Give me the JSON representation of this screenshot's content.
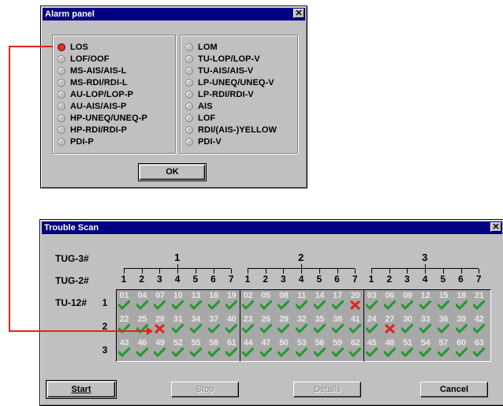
{
  "alarm_panel": {
    "title": "Alarm panel",
    "close_label": "✕",
    "left_options": [
      {
        "label": "LOS",
        "selected": true
      },
      {
        "label": "LOF/OOF",
        "selected": false
      },
      {
        "label": "MS-AIS/AIS-L",
        "selected": false
      },
      {
        "label": "MS-RDI/RDI-L",
        "selected": false
      },
      {
        "label": "AU-LOP/LOP-P",
        "selected": false
      },
      {
        "label": "AU-AIS/AIS-P",
        "selected": false
      },
      {
        "label": "HP-UNEQ/UNEQ-P",
        "selected": false
      },
      {
        "label": "HP-RDI/RDI-P",
        "selected": false
      },
      {
        "label": "PDI-P",
        "selected": false
      }
    ],
    "right_options": [
      {
        "label": "LOM",
        "selected": false
      },
      {
        "label": "TU-LOP/LOP-V",
        "selected": false
      },
      {
        "label": "TU-AIS/AIS-V",
        "selected": false
      },
      {
        "label": "LP-UNEQ/UNEQ-V",
        "selected": false
      },
      {
        "label": "LP-RDI/RDI-V",
        "selected": false
      },
      {
        "label": "AIS",
        "selected": false
      },
      {
        "label": "LOF",
        "selected": false
      },
      {
        "label": "RDI/(AIS-)YELLOW",
        "selected": false
      },
      {
        "label": "PDI-V",
        "selected": false
      }
    ],
    "ok_label": "OK"
  },
  "trouble_scan": {
    "title": "Trouble Scan",
    "close_label": "✕",
    "tug3_label": "TUG-3#",
    "tug2_label": "TUG-2#",
    "tu12_label": "TU-12#",
    "tug3_values": [
      "1",
      "2",
      "3"
    ],
    "tug2_values": [
      "1",
      "2",
      "3",
      "4",
      "5",
      "6",
      "7"
    ],
    "row_labels": [
      "1",
      "2",
      "3"
    ],
    "grid": [
      [
        [
          "01",
          "04",
          "07",
          "10",
          "13",
          "16",
          "19"
        ],
        [
          "02",
          "05",
          "08",
          "11",
          "14",
          "17",
          "20"
        ],
        [
          "03",
          "06",
          "09",
          "12",
          "15",
          "18",
          "21"
        ]
      ],
      [
        [
          "22",
          "25",
          "28",
          "31",
          "34",
          "37",
          "40"
        ],
        [
          "23",
          "26",
          "29",
          "32",
          "35",
          "38",
          "41"
        ],
        [
          "24",
          "27",
          "30",
          "33",
          "36",
          "39",
          "42"
        ]
      ],
      [
        [
          "43",
          "46",
          "49",
          "52",
          "55",
          "58",
          "61"
        ],
        [
          "44",
          "47",
          "50",
          "53",
          "56",
          "59",
          "62"
        ],
        [
          "45",
          "48",
          "51",
          "54",
          "57",
          "60",
          "63"
        ]
      ]
    ],
    "alarm_cells": [
      "20",
      "28",
      "27"
    ],
    "colors": {
      "ok": "#1f9a2e",
      "alarm": "#e02418",
      "connector": "#e02418"
    },
    "buttons": {
      "start": "Start",
      "stop": "Stop",
      "details": "Details",
      "cancel": "Cancel"
    }
  }
}
